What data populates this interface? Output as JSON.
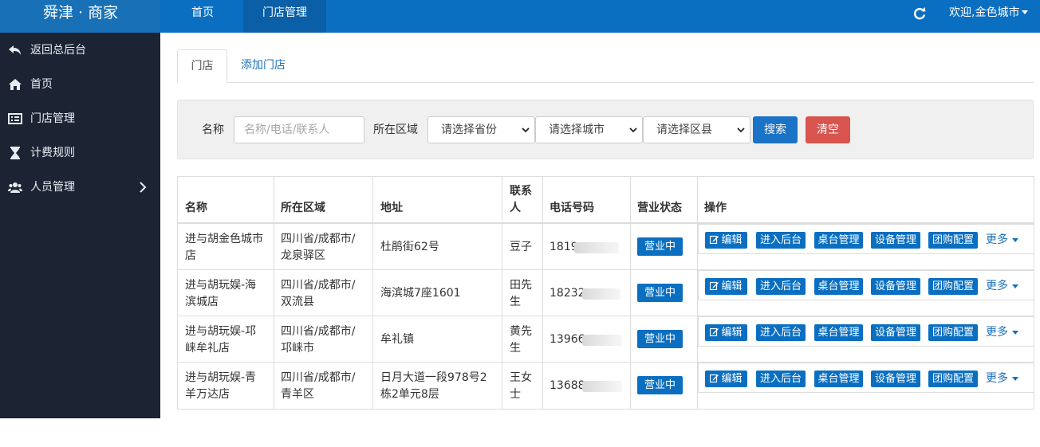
{
  "brand": "舜津 · 商家",
  "nav": {
    "home": "首页",
    "store": "门店管理"
  },
  "user": {
    "welcome": "欢迎,金色城市"
  },
  "sidebar": {
    "items": [
      {
        "label": "返回总后台",
        "icon": "back-arrow-icon"
      },
      {
        "label": "首页",
        "icon": "home-icon"
      },
      {
        "label": "门店管理",
        "icon": "list-icon"
      },
      {
        "label": "计费规则",
        "icon": "hourglass-icon"
      },
      {
        "label": "人员管理",
        "icon": "users-icon"
      }
    ]
  },
  "tabs": {
    "store": "门店",
    "add": "添加门店"
  },
  "search": {
    "name_label": "名称",
    "name_placeholder": "名称/电话/联系人",
    "region_label": "所在区域",
    "province": "请选择省份",
    "city": "请选择城市",
    "district": "请选择区县",
    "search_button": "搜索",
    "clear_button": "清空"
  },
  "table": {
    "headers": {
      "name": "名称",
      "region": "所在区域",
      "address": "地址",
      "contact_line1": "联系",
      "contact_line2": "人",
      "phone": "电话号码",
      "status": "营业状态",
      "actions": "操作"
    },
    "rows": [
      {
        "name1": "进与胡金色城市",
        "name2": "店",
        "region1": "四川省/成都市/",
        "region2": "龙泉驿区",
        "addr1": "杜鹃街62号",
        "addr2": "",
        "contact1": "豆子",
        "contact2": "",
        "phone": "1819",
        "status": "营业中"
      },
      {
        "name1": "进与胡玩娱-海",
        "name2": "滨城店",
        "region1": "四川省/成都市/",
        "region2": "双流县",
        "addr1": "海滨城7座1601",
        "addr2": "",
        "contact1": "田先",
        "contact2": "生",
        "phone": "18232",
        "status": "营业中"
      },
      {
        "name1": "进与胡玩娱-邛",
        "name2": "崃牟礼店",
        "region1": "四川省/成都市/",
        "region2": "邛崃市",
        "addr1": "牟礼镇",
        "addr2": "",
        "contact1": "黄先",
        "contact2": "生",
        "phone": "13966",
        "status": "营业中"
      },
      {
        "name1": "进与胡玩娱-青",
        "name2": "羊万达店",
        "region1": "四川省/成都市/",
        "region2": "青羊区",
        "addr1": "日月大道一段978号2",
        "addr2": "栋2单元8层",
        "contact1": "王女",
        "contact2": "士",
        "phone": "13688",
        "status": "营业中"
      }
    ],
    "actions": {
      "edit": "编辑",
      "enter_backend": "进入后台",
      "table_mgmt": "桌台管理",
      "device_mgmt": "设备管理",
      "group_config": "团购配置",
      "more": "更多"
    }
  }
}
